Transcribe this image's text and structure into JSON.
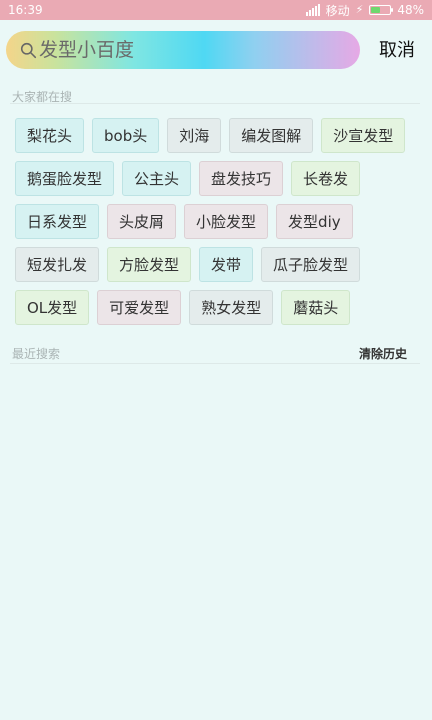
{
  "status_bar": {
    "time": "16:39",
    "carrier": "移动",
    "battery": "48%",
    "battery_level": 0.48
  },
  "search": {
    "placeholder": "发型小百度",
    "value": "",
    "cancel_label": "取消"
  },
  "popular": {
    "title": "大家都在搜",
    "rows": [
      [
        {
          "label": "梨花头",
          "color": "cyan"
        },
        {
          "label": "bob头",
          "color": "cyan"
        },
        {
          "label": "刘海",
          "color": "grey"
        },
        {
          "label": "编发图解",
          "color": "grey"
        },
        {
          "label": "沙宣发型",
          "color": "green"
        }
      ],
      [
        {
          "label": "鹅蛋脸发型",
          "color": "cyan"
        },
        {
          "label": "公主头",
          "color": "cyan"
        },
        {
          "label": "盘发技巧",
          "color": "pink"
        },
        {
          "label": "长卷发",
          "color": "green"
        }
      ],
      [
        {
          "label": "日系发型",
          "color": "cyan"
        },
        {
          "label": "头皮屑",
          "color": "pink"
        },
        {
          "label": "小脸发型",
          "color": "pink"
        },
        {
          "label": "发型diy",
          "color": "pink"
        }
      ],
      [
        {
          "label": "短发扎发",
          "color": "grey"
        },
        {
          "label": "方脸发型",
          "color": "green"
        },
        {
          "label": "发带",
          "color": "cyan"
        },
        {
          "label": "瓜子脸发型",
          "color": "grey"
        }
      ],
      [
        {
          "label": "OL发型",
          "color": "green"
        },
        {
          "label": "可爱发型",
          "color": "pink"
        },
        {
          "label": "熟女发型",
          "color": "grey"
        },
        {
          "label": "蘑菇头",
          "color": "green"
        }
      ]
    ]
  },
  "recent": {
    "title": "最近搜索",
    "clear_label": "清除历史",
    "items": []
  },
  "colors": {
    "status_bar": "#eaaab4",
    "background": "#eaf8f7",
    "tag_cyan": "#d6f2f2",
    "tag_grey": "#e4ecec",
    "tag_green": "#e4f4e0",
    "tag_pink": "#ece5e8"
  }
}
